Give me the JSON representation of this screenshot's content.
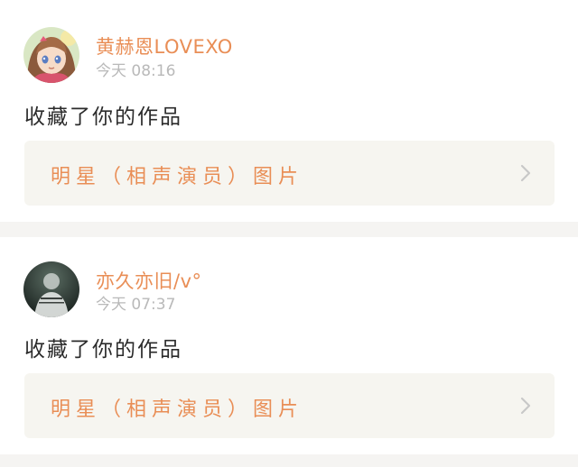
{
  "feed": {
    "items": [
      {
        "username": "黄赫恩LOVEXO",
        "timestamp": "今天 08:16",
        "action": "收藏了你的作品",
        "work_title": "明星（相声演员）图片",
        "avatar_icon": "anime-girl-avatar-icon"
      },
      {
        "username": "亦久亦旧/v°",
        "timestamp": "今天 07:37",
        "action": "收藏了你的作品",
        "work_title": "明星（相声演员）图片",
        "avatar_icon": "dark-photo-avatar-icon"
      }
    ]
  },
  "colors": {
    "accent": "#e98e56",
    "timestamp": "#b9b9b9",
    "text": "#2b2b2b",
    "link_background": "#f6f5f0",
    "page_background": "#f5f4f2"
  }
}
